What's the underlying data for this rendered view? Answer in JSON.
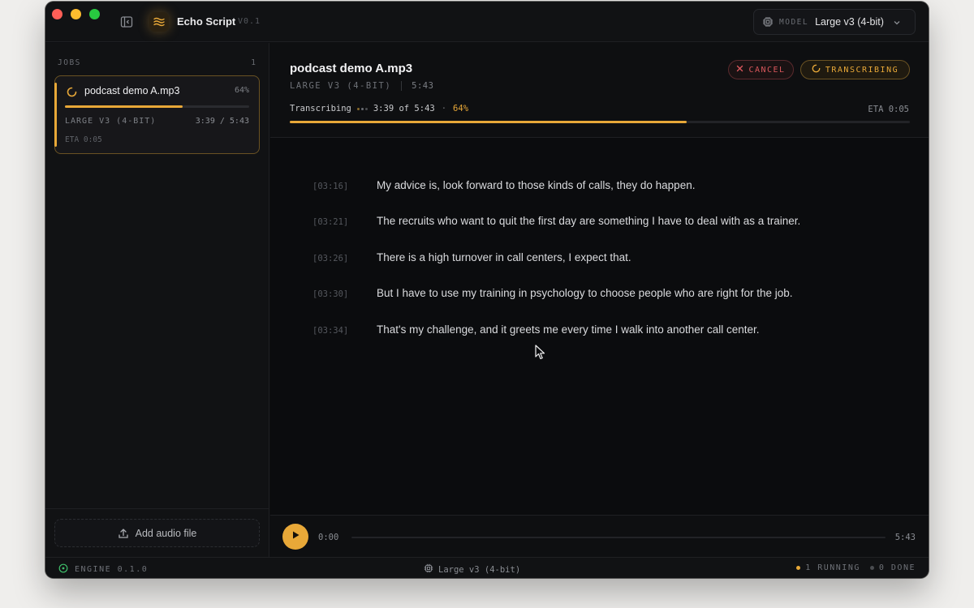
{
  "app": {
    "name": "Echo Script",
    "version": "V0.1"
  },
  "toolbar": {
    "model_label": "MODEL",
    "model_value": "Large v3 (4-bit)"
  },
  "sidebar": {
    "jobs_header": "JOBS",
    "jobs_count": "1",
    "jobs": [
      {
        "name": "podcast demo A.mp3",
        "percent": "64%",
        "progress": 0.64,
        "model": "LARGE V3 (4-BIT)",
        "time": "3:39 / 5:43",
        "eta": "ETA 0:05"
      }
    ],
    "add_label": "Add audio file"
  },
  "main": {
    "title": "podcast demo A.mp3",
    "model": "LARGE V3 (4-BIT)",
    "duration": "5:43",
    "cancel_label": "CANCEL",
    "status_label": "TRANSCRIBING",
    "progress": {
      "label": "Transcribing",
      "current": "3:39 of 5:43",
      "sep": "·",
      "percent": "64%",
      "fraction": 0.64,
      "eta": "ETA 0:05"
    },
    "segments": [
      {
        "ts": "[03:16]",
        "text": "My advice is, look forward to those kinds of calls, they do happen."
      },
      {
        "ts": "[03:21]",
        "text": "The recruits who want to quit the first day are something I have to deal with as a trainer."
      },
      {
        "ts": "[03:26]",
        "text": "There is a high turnover in call centers, I expect that."
      },
      {
        "ts": "[03:30]",
        "text": "But I have to use my training in psychology to choose people who are right for the job."
      },
      {
        "ts": "[03:34]",
        "text": "That's my challenge, and it greets me every time I walk into another call center."
      }
    ]
  },
  "player": {
    "current": "0:00",
    "total": "5:43"
  },
  "statusbar": {
    "engine": "ENGINE 0.1.0",
    "model": "Large v3 (4-bit)",
    "running": "1 RUNNING",
    "done": "0 DONE"
  },
  "colors": {
    "accent": "#e8a838",
    "danger": "#d9575c",
    "background": "#0b0c0e"
  },
  "icons": [
    "sidebar-toggle-icon",
    "waveform-logo-icon",
    "chip-icon",
    "chevron-down-icon",
    "spinner-icon",
    "upload-icon",
    "close-icon",
    "play-icon",
    "status-circle-icon"
  ]
}
